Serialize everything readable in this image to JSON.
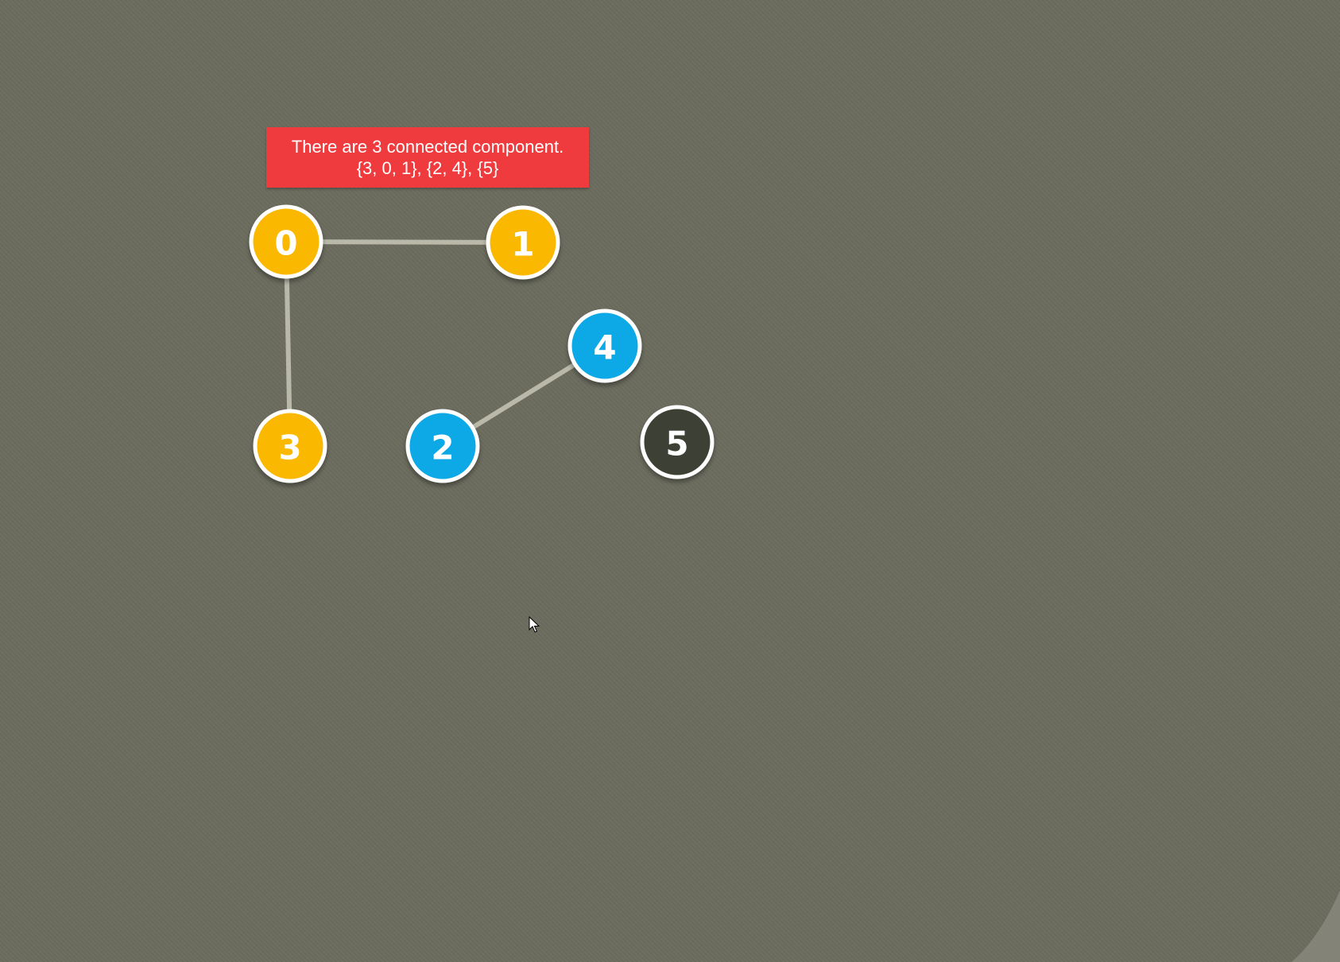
{
  "status": {
    "line1": "There are 3 connected component.",
    "line2": "{3, 0, 1}, {2, 4}, {5}"
  },
  "colors": {
    "background": "#6b6c5e",
    "status_bg": "#ef3b3e",
    "component_a": "#fbb800",
    "component_b": "#0aa9e6",
    "component_c": "#3e3f34",
    "edge": "#b9b8a9",
    "vertex_border": "#ffffff"
  },
  "graph": {
    "vertices": [
      {
        "id": "0",
        "label": "0",
        "component": "component_a"
      },
      {
        "id": "1",
        "label": "1",
        "component": "component_a"
      },
      {
        "id": "2",
        "label": "2",
        "component": "component_b"
      },
      {
        "id": "3",
        "label": "3",
        "component": "component_a"
      },
      {
        "id": "4",
        "label": "4",
        "component": "component_b"
      },
      {
        "id": "5",
        "label": "5",
        "component": "component_c"
      }
    ],
    "edges": [
      {
        "from": "0",
        "to": "1"
      },
      {
        "from": "0",
        "to": "3"
      },
      {
        "from": "2",
        "to": "4"
      }
    ]
  }
}
